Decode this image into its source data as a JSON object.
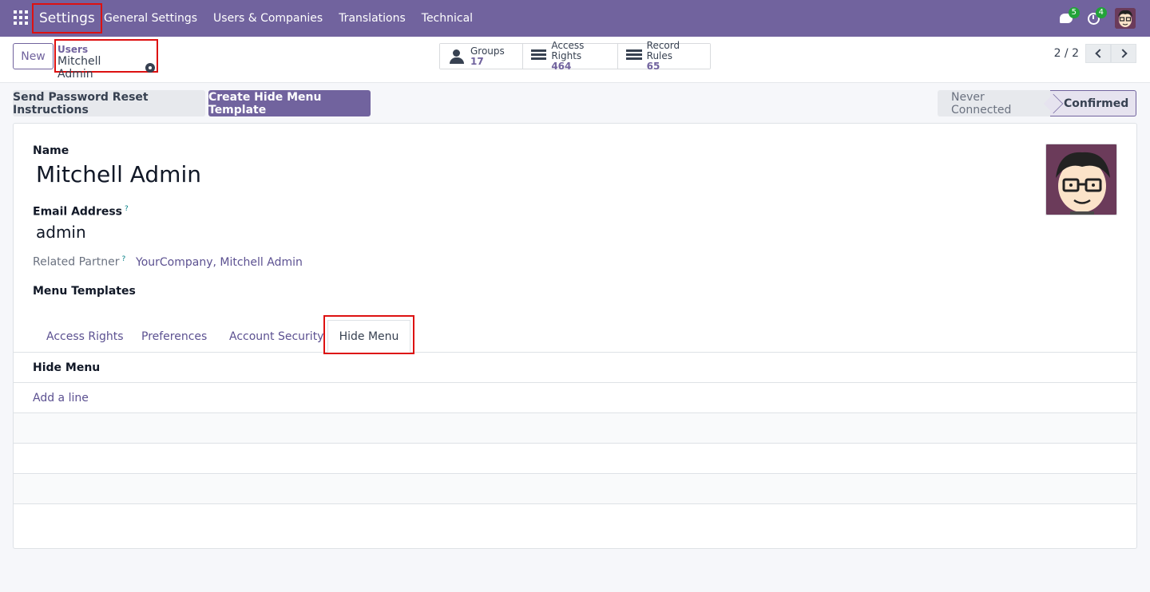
{
  "navbar": {
    "brand": "Settings",
    "menu": [
      "General Settings",
      "Users & Companies",
      "Translations",
      "Technical"
    ],
    "messages_count": "5",
    "activities_count": "4",
    "bg_color": "#71639e"
  },
  "control_panel": {
    "new_label": "New",
    "breadcrumb_parent": "Users",
    "breadcrumb_current": "Mitchell Admin",
    "smart_buttons": {
      "groups": {
        "label": "Groups",
        "value": "17",
        "icon": "users-icon"
      },
      "access_rights": {
        "label": "Access Rights",
        "value": "464",
        "icon": "list-icon"
      },
      "record_rules": {
        "label": "Record Rules",
        "value": "65",
        "icon": "list-icon"
      }
    },
    "pager": "2 / 2"
  },
  "actions": {
    "reset_password": "Send Password Reset Instructions",
    "create_template": "Create Hide Menu Template"
  },
  "status": {
    "never_connected": "Never Connected",
    "confirmed": "Confirmed",
    "active": "Confirmed"
  },
  "form": {
    "name_label": "Name",
    "name_value": "Mitchell Admin",
    "email_label": "Email Address",
    "email_value": "admin",
    "partner_label": "Related Partner",
    "partner_value": "YourCompany, Mitchell Admin",
    "templates_label": "Menu Templates",
    "help_mark": "?"
  },
  "tabs": {
    "access_rights": "Access Rights",
    "preferences": "Preferences",
    "account_security": "Account Security",
    "hide_menu": "Hide Menu",
    "active": "Hide Menu"
  },
  "hide_menu_list": {
    "header": "Hide Menu",
    "add_line": "Add a line"
  }
}
